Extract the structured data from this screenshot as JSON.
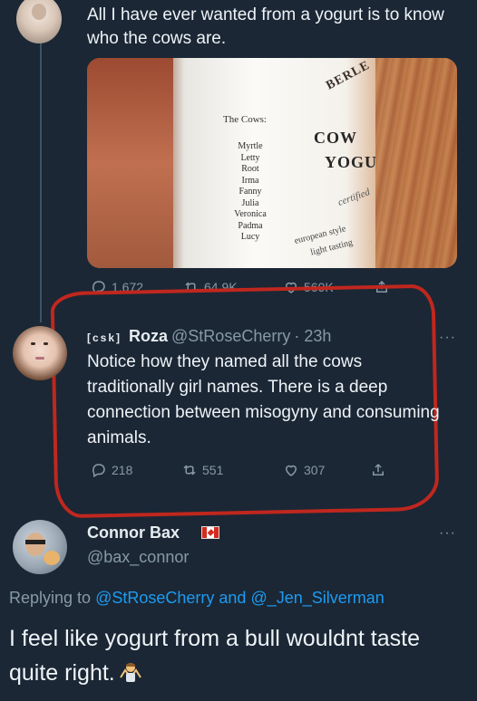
{
  "tweet1": {
    "text": "All I have ever wanted from a yogurt is to know who the cows are.",
    "image": {
      "label_title": "The Cows:",
      "cow_names": [
        "Myrtle",
        "Letty",
        "Root",
        "Irma",
        "Fanny",
        "Julia",
        "Veronica",
        "Padma",
        "Lucy"
      ],
      "brand": "BERLE",
      "product_line1": "COW",
      "product_line2": "YOGU",
      "certified": "certified",
      "euro_line1": "european style",
      "euro_line2": "light tasting"
    },
    "actions": {
      "replies": "1,672",
      "retweets": "64.9K",
      "likes": "569K"
    }
  },
  "tweet2": {
    "badge": "[csk]",
    "name": "Roza",
    "handle": "@StRoseCherry",
    "time": "· 23h",
    "more": "···",
    "text": "Notice how they named all the cows traditionally girl names. There is a deep connection between misogyny and consuming animals.",
    "actions": {
      "replies": "218",
      "retweets": "551",
      "likes": "307"
    }
  },
  "tweet3": {
    "name": "Connor Bax",
    "handle": "@bax_connor",
    "more": "···",
    "replying_prefix": "Replying to",
    "replying_to_1": "@StRoseCherry",
    "replying_and": "and",
    "replying_to_2": "@_Jen_Silverman",
    "text": "I feel like yogurt from a bull wouldnt taste quite right.",
    "emoji": "man-shrugging-emoji"
  },
  "colors": {
    "background": "#1b2735",
    "secondary_text": "#8899a6",
    "link": "#1d9bf0",
    "annotation_red": "#c0271e"
  }
}
